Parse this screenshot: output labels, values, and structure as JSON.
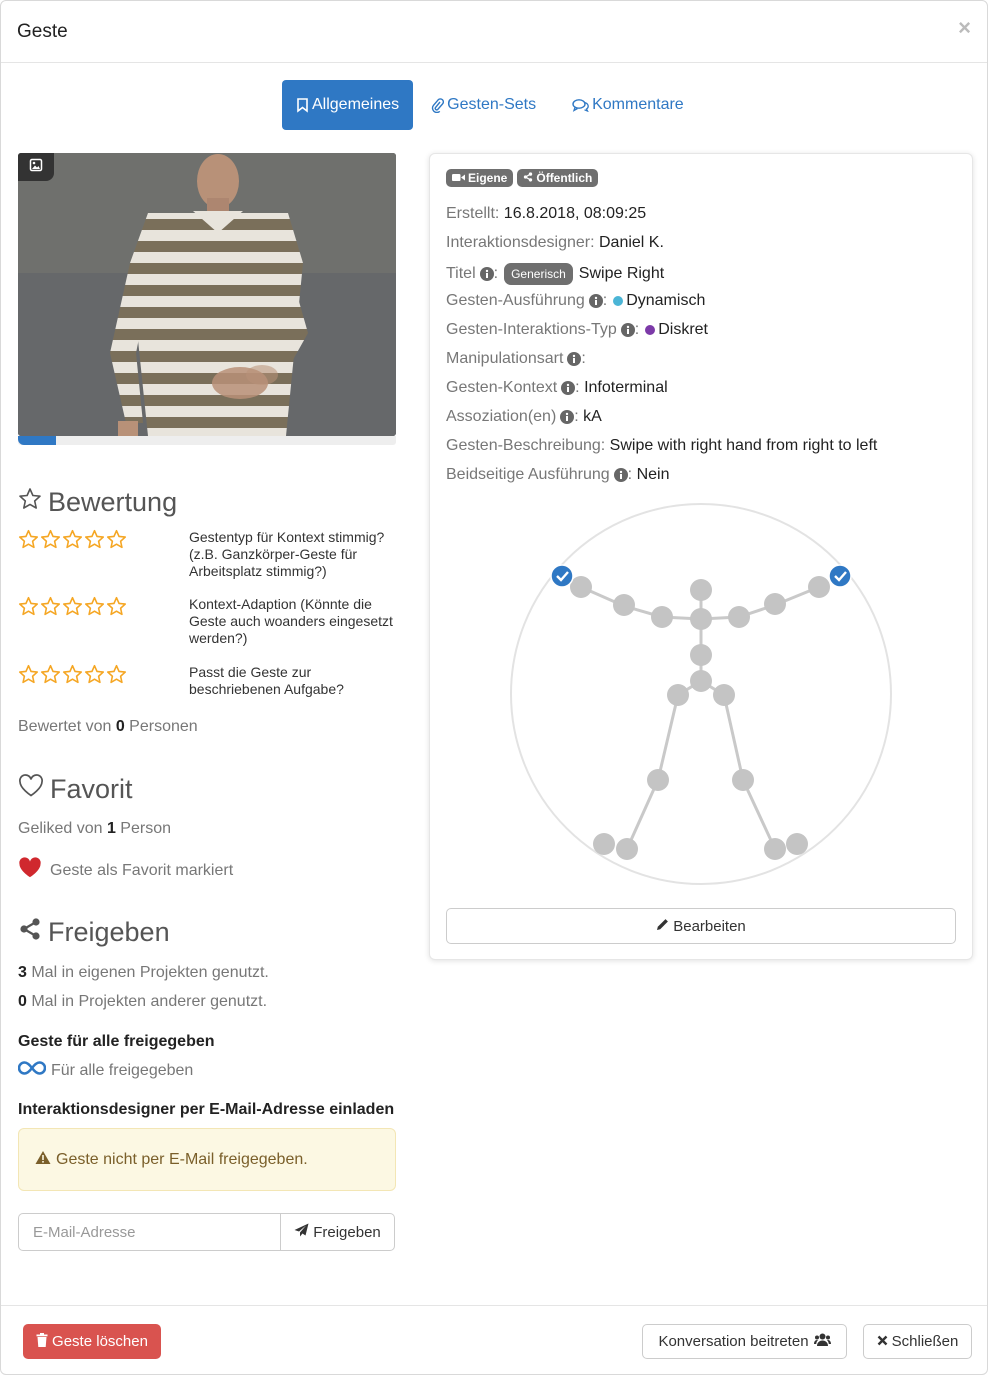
{
  "modal": {
    "title": "Geste",
    "close_glyph": "×"
  },
  "tabs": [
    {
      "label": "Allgemeines",
      "icon": "bookmark-icon",
      "active": true
    },
    {
      "label": "Gesten-Sets",
      "icon": "paperclip-icon",
      "active": false
    },
    {
      "label": "Kommentare",
      "icon": "comments-icon",
      "active": false
    }
  ],
  "video": {
    "badge_icon": "image-icon",
    "progress": 0.1
  },
  "rating": {
    "heading": "Bewertung",
    "items": [
      {
        "stars": 0,
        "max": 5,
        "text": "Gestentyp für Kontext stimmig? (z.B. Ganzkörper-Geste für Arbeitsplatz stimmig?)"
      },
      {
        "stars": 0,
        "max": 5,
        "text": "Kontext-Adaption (Könnte die Geste auch woanders eingesetzt werden?)"
      },
      {
        "stars": 0,
        "max": 5,
        "text": "Passt die Geste zur beschriebenen Aufgabe?"
      }
    ],
    "rated_prefix": "Bewertet von ",
    "rated_count": "0",
    "rated_suffix": " Personen"
  },
  "favorite": {
    "heading": "Favorit",
    "liked_prefix": "Geliked von ",
    "liked_count": "1",
    "liked_suffix": " Person",
    "marked_label": "Geste als Favorit markiert"
  },
  "share": {
    "heading": "Freigeben",
    "own_count": "3",
    "own_text": " Mal in eigenen Projekten genutzt.",
    "other_count": "0",
    "other_text": " Mal in Projekten anderer genutzt.",
    "all_heading": "Geste für alle freigegeben",
    "all_label": "Für alle freigegeben",
    "invite_heading": "Interaktionsdesigner per E-Mail-Adresse einladen",
    "alert_text": "Geste nicht per E-Mail freigegeben.",
    "email_placeholder": "E-Mail-Adresse",
    "share_button": "Freigeben"
  },
  "details": {
    "badges": [
      {
        "label": "Eigene",
        "icon": "video-icon"
      },
      {
        "label": "Öffentlich",
        "icon": "share-icon"
      }
    ],
    "created_label": "Erstellt:",
    "created_value": "16.8.2018, 08:09:25",
    "designer_label": "Interaktionsdesigner:",
    "designer_value": "Daniel K.",
    "title_label": "Titel",
    "title_badge": "Generisch",
    "title_value": "Swipe Right",
    "execution_label": "Gesten-Ausführung",
    "execution_value": "Dynamisch",
    "execution_color": "#4bb5d6",
    "interaction_label": "Gesten-Interaktions-Typ",
    "interaction_value": "Diskret",
    "interaction_color": "#7c3aa8",
    "manipulation_label": "Manipulationsart",
    "context_label": "Gesten-Kontext",
    "context_value": "Infoterminal",
    "association_label": "Assoziation(en)",
    "association_value": "kA",
    "description_label": "Gesten-Beschreibung:",
    "description_value": "Swipe with right hand from right to left",
    "bilateral_label": "Beidseitige Ausführung",
    "bilateral_value": "Nein",
    "edit_button": "Bearbeiten"
  },
  "footer": {
    "delete_button": "Geste löschen",
    "conversation_button": "Konversation beitreten",
    "close_button": "Schließen"
  },
  "colors": {
    "primary": "#2f78c4",
    "danger": "#d9534f",
    "star": "#f5a623",
    "heart": "#d0282e"
  }
}
